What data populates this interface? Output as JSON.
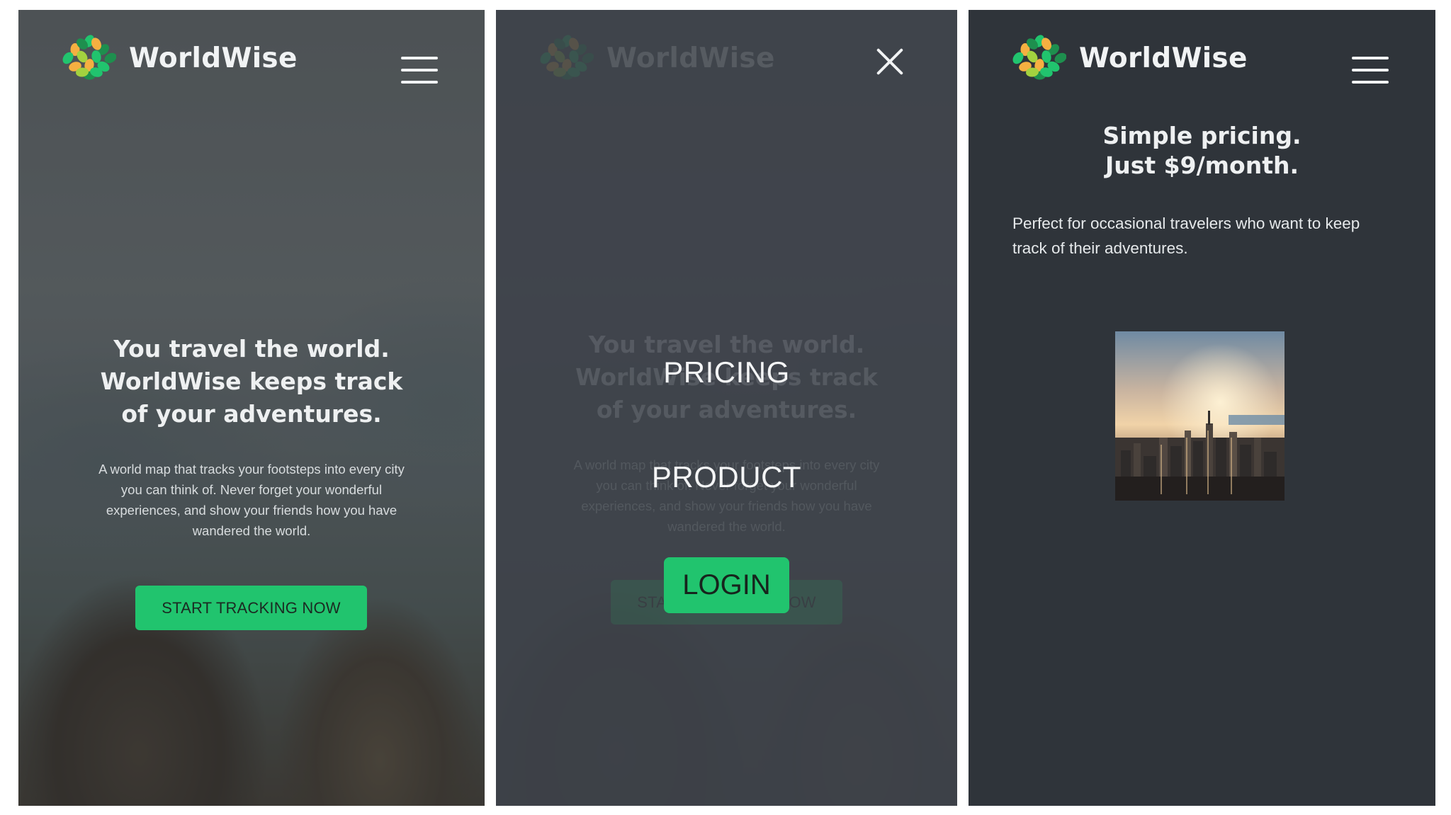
{
  "brand": {
    "name": "WorldWise",
    "logo_colors": [
      "#f5b041",
      "#21c46e",
      "#1e8f4e",
      "#a3d13f"
    ]
  },
  "colors": {
    "accent": "#21c46e",
    "dark_background": "#2f343a",
    "text_light": "#eef0f1"
  },
  "screens": {
    "home": {
      "menu_icon": "hamburger-menu-icon",
      "headline": "You travel the world. WorldWise keeps track of your adventures.",
      "description": "A world map that tracks your footsteps into every city you can think of. Never forget your wonderful experiences, and show your friends how you have wandered the world.",
      "cta_label": "START TRACKING NOW"
    },
    "menu_open": {
      "close_icon": "close-icon",
      "nav_items": [
        "PRICING",
        "PRODUCT"
      ],
      "login_label": "LOGIN"
    },
    "pricing": {
      "menu_icon": "hamburger-menu-icon",
      "title_line1": "Simple pricing.",
      "title_line2": "Just $9/month.",
      "description": "Perfect for occasional travelers who want to keep track of their adventures."
    }
  }
}
